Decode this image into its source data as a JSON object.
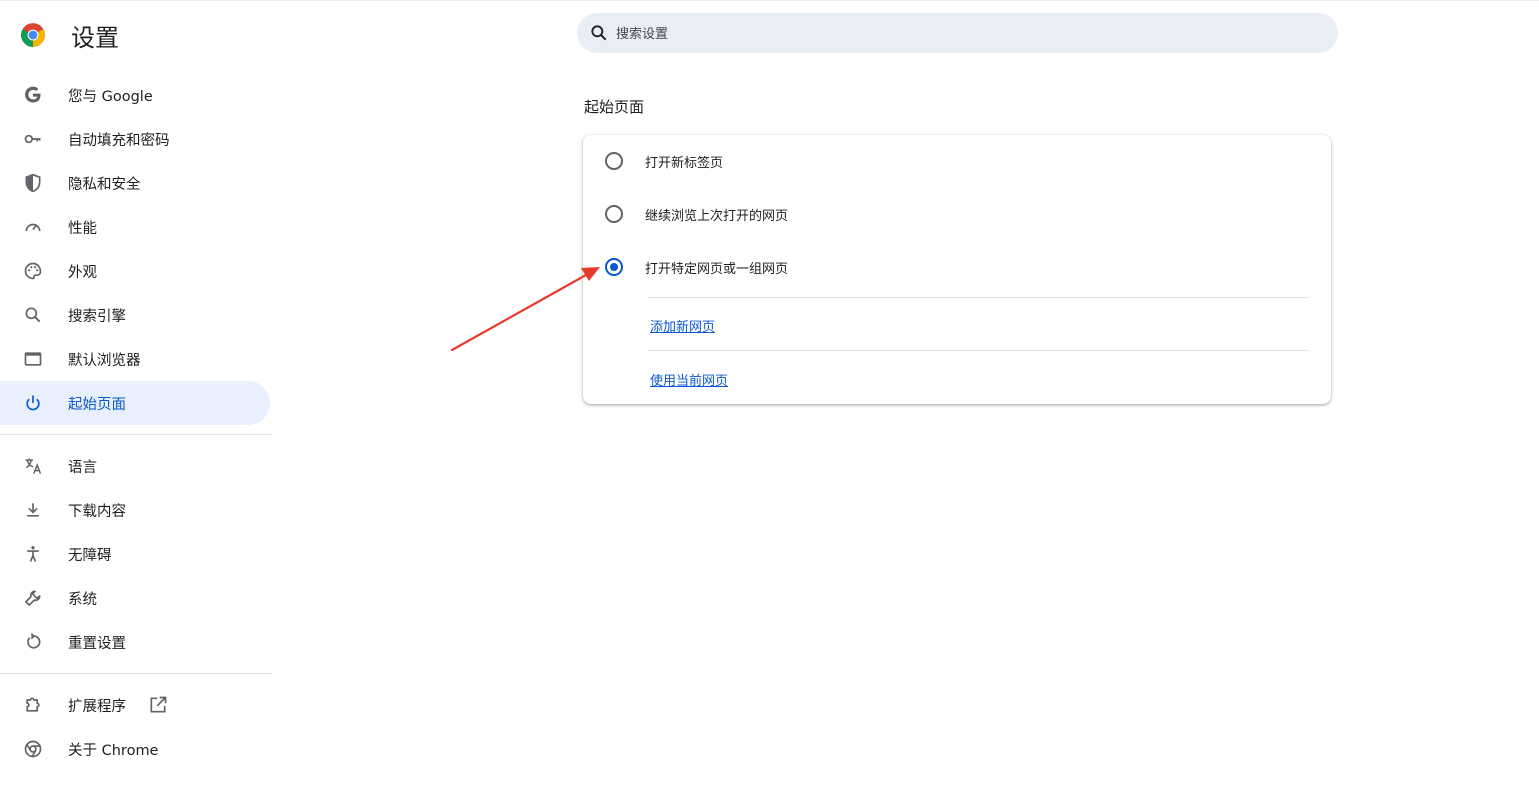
{
  "app": {
    "title": "设置"
  },
  "search": {
    "placeholder": "搜索设置"
  },
  "sidebar": {
    "items": [
      {
        "label": "您与 Google",
        "icon": "google-icon"
      },
      {
        "label": "自动填充和密码",
        "icon": "key-icon"
      },
      {
        "label": "隐私和安全",
        "icon": "shield-icon"
      },
      {
        "label": "性能",
        "icon": "speedometer-icon"
      },
      {
        "label": "外观",
        "icon": "palette-icon"
      },
      {
        "label": "搜索引擎",
        "icon": "search-icon"
      },
      {
        "label": "默认浏览器",
        "icon": "browser-window-icon"
      },
      {
        "label": "起始页面",
        "icon": "power-icon",
        "active": true
      },
      {
        "label": "语言",
        "icon": "translate-icon"
      },
      {
        "label": "下载内容",
        "icon": "download-icon"
      },
      {
        "label": "无障碍",
        "icon": "accessibility-icon"
      },
      {
        "label": "系统",
        "icon": "wrench-icon"
      },
      {
        "label": "重置设置",
        "icon": "reset-icon"
      },
      {
        "label": "扩展程序",
        "icon": "puzzle-icon"
      },
      {
        "label": "关于 Chrome",
        "icon": "chrome-icon"
      }
    ]
  },
  "main": {
    "section_title": "起始页面",
    "options": [
      {
        "label": "打开新标签页",
        "checked": false
      },
      {
        "label": "继续浏览上次打开的网页",
        "checked": false
      },
      {
        "label": "打开特定网页或一组网页",
        "checked": true
      }
    ],
    "links": [
      "添加新网页",
      "使用当前网页"
    ]
  },
  "colors": {
    "accent": "#0b57d0",
    "active_bg": "#e8effd",
    "search_bg": "#e9eef6",
    "annotation_arrow": "#e8392c"
  }
}
